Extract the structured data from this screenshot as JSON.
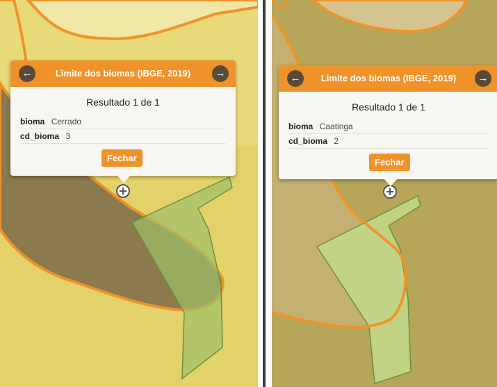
{
  "left_popup": {
    "title": "Limite dos biomas (IBGE, 2019)",
    "result": "Resultado 1 de 1",
    "attributes": [
      {
        "key": "bioma",
        "value": "Cerrado"
      },
      {
        "key": "cd_bioma",
        "value": "3"
      }
    ],
    "close_label": "Fechar",
    "prev_icon": "arrow-left-icon",
    "next_icon": "arrow-right-icon"
  },
  "right_popup": {
    "title": "Limite dos biomas (IBGE, 2019)",
    "result": "Resultado 1 de 1",
    "attributes": [
      {
        "key": "bioma",
        "value": "Caatinga"
      },
      {
        "key": "cd_bioma",
        "value": "2"
      }
    ],
    "close_label": "Fechar",
    "prev_icon": "arrow-left-icon",
    "next_icon": "arrow-right-icon"
  },
  "colors": {
    "accent": "#f0922a",
    "nav_button": "#5a4a3a",
    "popup_bg": "#f7f6f2"
  }
}
